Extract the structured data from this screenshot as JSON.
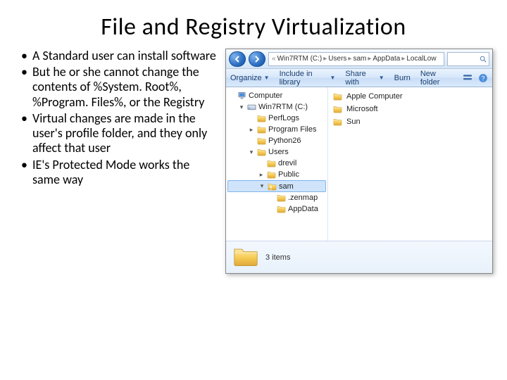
{
  "title": "File and Registry Virtualization",
  "bullets": [
    "A Standard user can install software",
    "But he or she cannot change the contents of %System. Root%, %Program. Files%, or the Registry",
    "Virtual changes are made in the user's profile folder, and they only affect that user",
    "IE's Protected Mode works the same way"
  ],
  "explorer": {
    "breadcrumb": [
      "Win7RTM (C:)",
      "Users",
      "sam",
      "AppData",
      "LocalLow"
    ],
    "toolbar": {
      "organize": "Organize",
      "include": "Include in library",
      "share": "Share with",
      "burn": "Burn",
      "newfolder": "New folder"
    },
    "search_placeholder": "Search",
    "tree": [
      {
        "depth": 0,
        "exp": "",
        "icon": "computer",
        "label": "Computer"
      },
      {
        "depth": 1,
        "exp": "▾",
        "icon": "drive",
        "label": "Win7RTM (C:)"
      },
      {
        "depth": 2,
        "exp": "",
        "icon": "folder",
        "label": "PerfLogs"
      },
      {
        "depth": 2,
        "exp": "▸",
        "icon": "folder",
        "label": "Program Files"
      },
      {
        "depth": 2,
        "exp": "",
        "icon": "folder",
        "label": "Python26"
      },
      {
        "depth": 2,
        "exp": "▾",
        "icon": "folder",
        "label": "Users"
      },
      {
        "depth": 3,
        "exp": "",
        "icon": "folder",
        "label": "drevil"
      },
      {
        "depth": 3,
        "exp": "▸",
        "icon": "folder",
        "label": "Public"
      },
      {
        "depth": 3,
        "exp": "▾",
        "icon": "user",
        "label": "sam",
        "sel": true
      },
      {
        "depth": 4,
        "exp": "",
        "icon": "folder",
        "label": ".zenmap"
      },
      {
        "depth": 4,
        "exp": "",
        "icon": "folder",
        "label": "AppData"
      }
    ],
    "items": [
      {
        "icon": "folder",
        "label": "Apple Computer"
      },
      {
        "icon": "folder",
        "label": "Microsoft"
      },
      {
        "icon": "folder",
        "label": "Sun"
      }
    ],
    "status": "3 items"
  }
}
